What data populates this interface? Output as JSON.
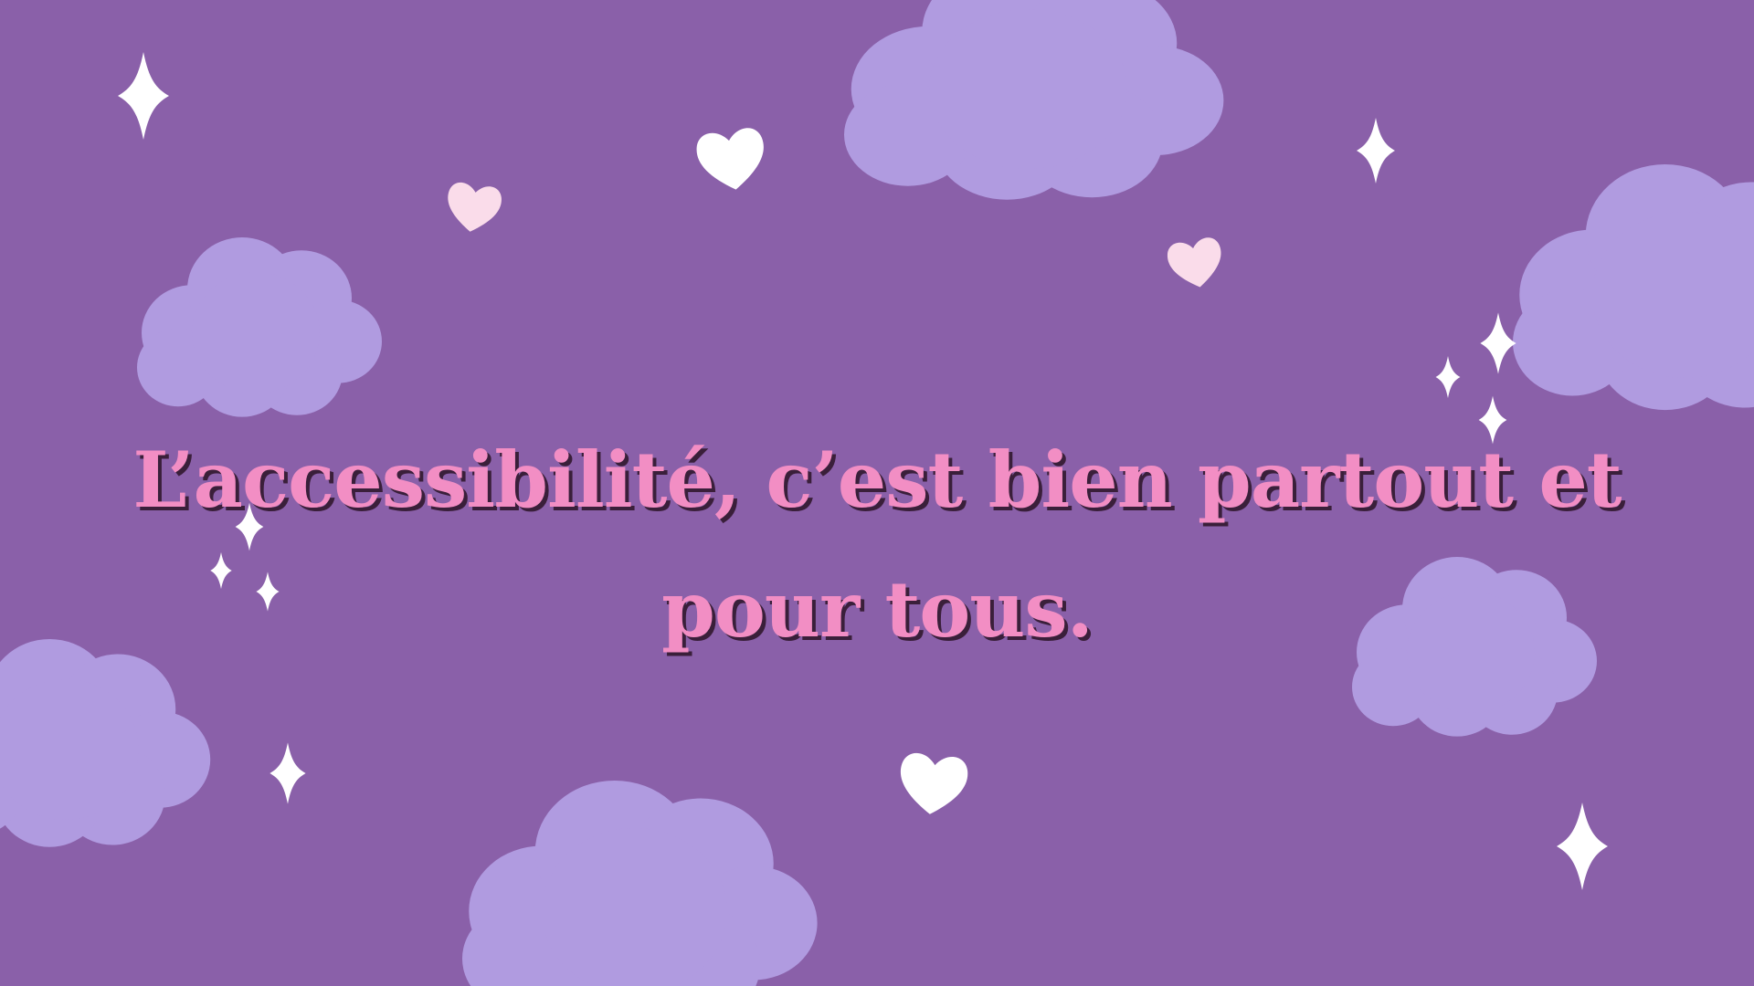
{
  "slide": {
    "headline_line1": "L’accessibilité, c’est bien partout et",
    "headline_line2": "pour tous."
  },
  "colors": {
    "background": "#8a60a9",
    "cloud": "#b09be0",
    "headline": "#f28ec4",
    "headline_shadow": "#3a1f3a",
    "heart_white": "#ffffff",
    "heart_pink": "#fadcea",
    "sparkle": "#ffffff"
  },
  "decorations": {
    "clouds": "cloud-icon",
    "hearts": "heart-icon",
    "sparkles": "sparkle-icon"
  }
}
